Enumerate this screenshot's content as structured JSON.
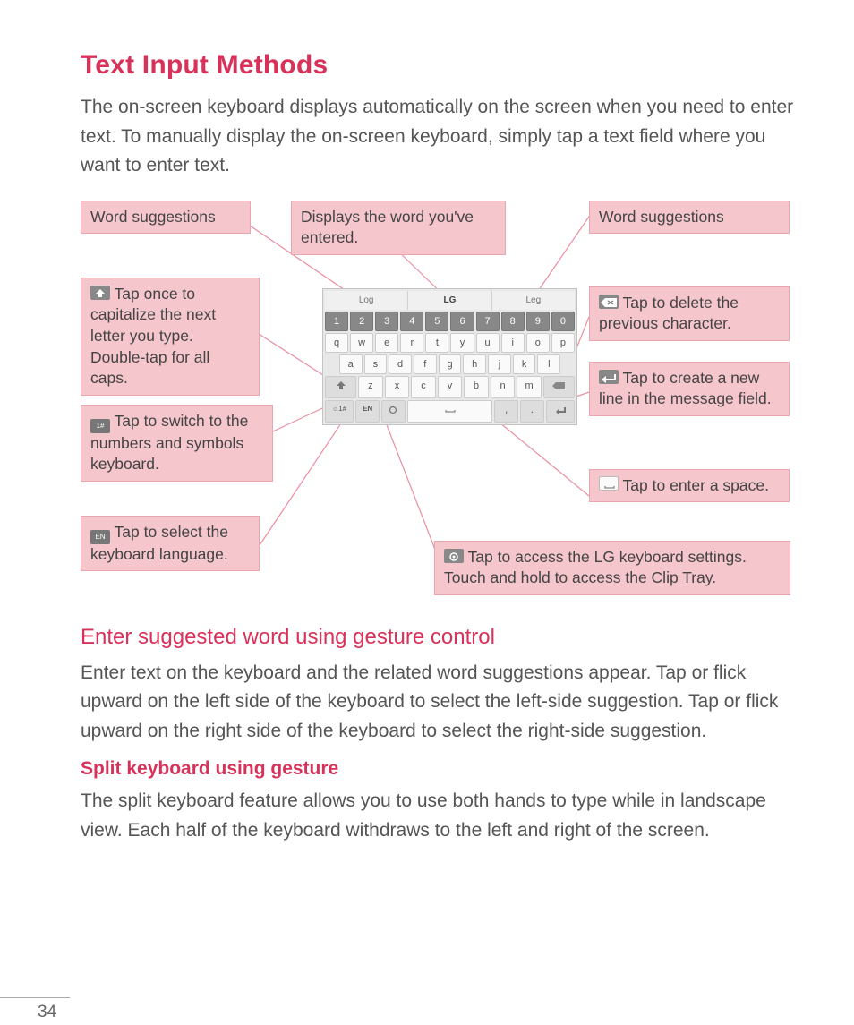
{
  "title": "Text Input Methods",
  "intro": "The on-screen keyboard displays automatically on the screen when you need to enter text. To manually display the on-screen keyboard, simply tap a text field where you want to enter text.",
  "callouts": {
    "c_ws_left": "Word suggestions",
    "c_display": "Displays the word you've entered.",
    "c_ws_right": "Word suggestions",
    "c_shift": " Tap once to capitalize the next letter you type. Double-tap for all caps.",
    "c_sym": " Tap to switch to the numbers and symbols keyboard.",
    "c_lang": " Tap to select the keyboard language.",
    "c_del": " Tap to delete the previous character.",
    "c_enter": " Tap to create a new line in the message field.",
    "c_space": " Tap to enter a space.",
    "c_settings": " Tap to access the LG keyboard settings. Touch and hold to access the Clip Tray."
  },
  "keyboard": {
    "suggestions": [
      "Log",
      "LG",
      "Leg"
    ],
    "row_nums": [
      "1",
      "2",
      "3",
      "4",
      "5",
      "6",
      "7",
      "8",
      "9",
      "0"
    ],
    "row1": [
      "q",
      "w",
      "e",
      "r",
      "t",
      "y",
      "u",
      "i",
      "o",
      "p"
    ],
    "row2": [
      "a",
      "s",
      "d",
      "f",
      "g",
      "h",
      "j",
      "k",
      "l"
    ],
    "row3": [
      "z",
      "x",
      "c",
      "v",
      "b",
      "n",
      "m"
    ],
    "bottom": {
      "sym": "1#",
      "lang": "EN",
      "gear": "",
      "space": "⌴",
      "comma": ",",
      "dot": ".",
      "enter": "↵"
    }
  },
  "section2_title": "Enter suggested word using gesture control",
  "section2_body": "Enter text on the keyboard and the related word suggestions appear. Tap or flick upward on the left side of the keyboard to select the left-side suggestion. Tap or flick upward on the right side of the keyboard to select the right-side suggestion.",
  "section3_title": "Split keyboard using gesture",
  "section3_body": "The split keyboard feature allows you to use both hands to type while in landscape view. Each half of the keyboard withdraws to the left and right of the screen.",
  "page_number": "34"
}
